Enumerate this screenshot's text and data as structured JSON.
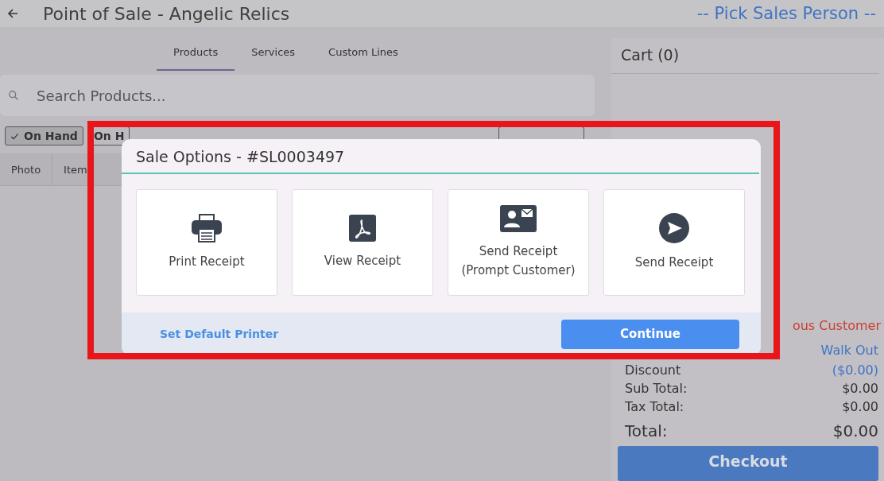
{
  "header": {
    "title": "Point of Sale - Angelic Relics",
    "sales_person": "-- Pick Sales Person --"
  },
  "tabs": [
    {
      "label": "Products",
      "selected": true
    },
    {
      "label": "Services",
      "selected": false
    },
    {
      "label": "Custom Lines",
      "selected": false
    }
  ],
  "search": {
    "placeholder": "Search Products..."
  },
  "filters": [
    {
      "label": "On Hand",
      "checked": true
    },
    {
      "label": "On H",
      "checked": false
    }
  ],
  "table": {
    "columns": [
      "Photo",
      "Item"
    ]
  },
  "cart": {
    "title": "Cart (0)",
    "customer": "ous Customer",
    "summary": [
      {
        "kind": "link",
        "value": "Walk Out"
      },
      {
        "kind": "link",
        "label": "Discount",
        "value": "($0.00)"
      },
      {
        "kind": "plain",
        "label": "Sub Total:",
        "value": "$0.00"
      },
      {
        "kind": "plain",
        "label": "Tax Total:",
        "value": "$0.00"
      },
      {
        "kind": "total",
        "label": "Total:",
        "value": "$0.00"
      }
    ],
    "checkout": "Checkout"
  },
  "dialog": {
    "title": "Sale Options - #SL0003497",
    "options": [
      {
        "kind": "printer",
        "label": "Print Receipt"
      },
      {
        "kind": "pdf",
        "label": "View Receipt"
      },
      {
        "kind": "contact",
        "label": "Send Receipt\n(Prompt Customer)"
      },
      {
        "kind": "send",
        "label": "Send Receipt"
      }
    ],
    "link": "Set Default Printer",
    "primary": "Continue"
  }
}
